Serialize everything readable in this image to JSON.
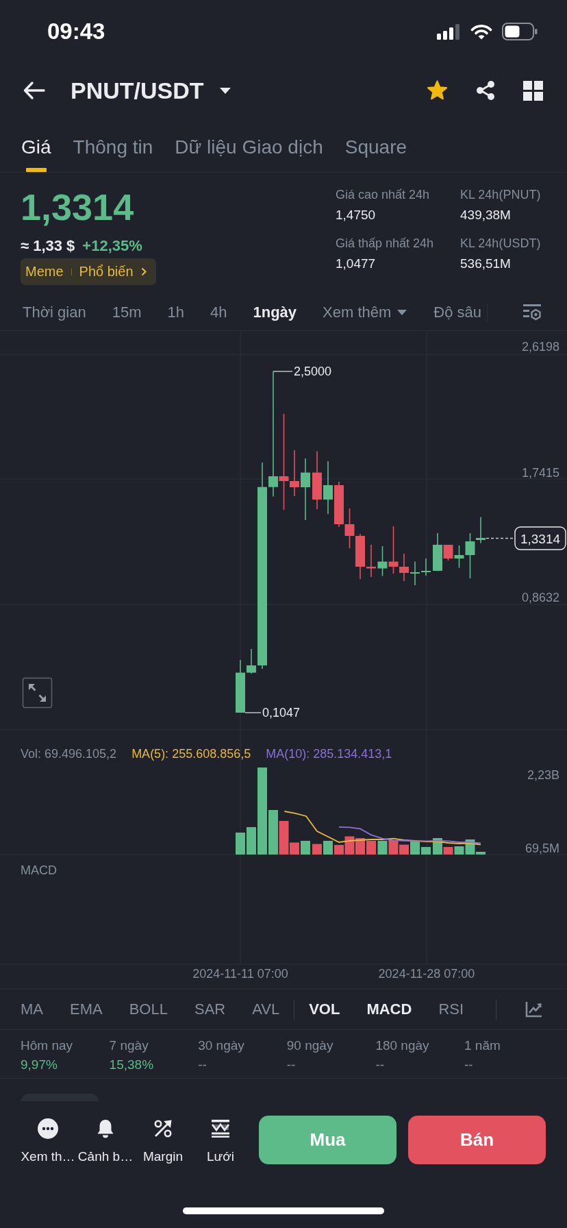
{
  "status_bar": {
    "time": "09:43"
  },
  "header": {
    "pair": "PNUT/USDT",
    "favorite": true
  },
  "tabs": [
    {
      "label": "Giá",
      "selected": true
    },
    {
      "label": "Thông tin",
      "selected": false
    },
    {
      "label": "Dữ liệu Giao dịch",
      "selected": false
    },
    {
      "label": "Square",
      "selected": false
    }
  ],
  "price": {
    "last": "1,3314",
    "fiat": "≈ 1,33 $",
    "change": "+12,35%",
    "rising": true,
    "tags": [
      "Meme",
      "Phổ biến"
    ]
  },
  "stats": [
    {
      "label": "Giá cao nhất 24h",
      "value": "1,4750"
    },
    {
      "label": "KL 24h(PNUT)",
      "value": "439,38M"
    },
    {
      "label": "Giá thấp nhất 24h",
      "value": "1,0477"
    },
    {
      "label": "KL 24h(USDT)",
      "value": "536,51M"
    }
  ],
  "intervals": [
    {
      "label": "Thời gian",
      "kind": "option",
      "selected": false
    },
    {
      "label": "15m",
      "kind": "option",
      "selected": false
    },
    {
      "label": "1h",
      "kind": "option",
      "selected": false
    },
    {
      "label": "4h",
      "kind": "option",
      "selected": false
    },
    {
      "label": "1ngày",
      "kind": "option",
      "selected": true
    },
    {
      "label": "Xem thêm",
      "kind": "menu",
      "selected": false
    },
    {
      "label": "Độ sâu",
      "kind": "option",
      "selected": false
    }
  ],
  "chart": {
    "price_axis": [
      "2,6198",
      "1,7415",
      "0,8632"
    ],
    "high_label": "2,5000",
    "low_label": "0,1047",
    "last_price": "1,3314",
    "volume_legend": [
      {
        "text": "Vol: 69.496.105,2",
        "color": "#848e9c"
      },
      {
        "text": "MA(5): 255.608.856,5",
        "color": "#e9b93c"
      },
      {
        "text": "MA(10): 285.134.413,1",
        "color": "#8c6fd8"
      }
    ],
    "volume_axis": [
      "2,23B",
      "69,5M"
    ],
    "macd_label": "MACD",
    "time_axis": [
      "2024-11-11 07:00",
      "2024-11-28 07:00"
    ]
  },
  "main_indicators": [
    {
      "label": "MA",
      "selected": false
    },
    {
      "label": "EMA",
      "selected": false
    },
    {
      "label": "BOLL",
      "selected": false
    },
    {
      "label": "SAR",
      "selected": false
    },
    {
      "label": "AVL",
      "selected": false
    }
  ],
  "sub_indicators": [
    {
      "label": "VOL",
      "selected": true
    },
    {
      "label": "MACD",
      "selected": true
    },
    {
      "label": "RSI",
      "selected": false
    }
  ],
  "performance": [
    {
      "label": "Hôm nay",
      "value": "9,97%",
      "rising": true
    },
    {
      "label": "7 ngày",
      "value": "15,38%",
      "rising": true
    },
    {
      "label": "30 ngày",
      "value": "--",
      "rising": false
    },
    {
      "label": "90 ngày",
      "value": "--",
      "rising": false
    },
    {
      "label": "180 ngày",
      "value": "--",
      "rising": false
    },
    {
      "label": "1 năm",
      "value": "--",
      "rising": false
    }
  ],
  "toolbar": [
    {
      "label": "Xem th…"
    },
    {
      "label": "Cảnh b…"
    },
    {
      "label": "Margin"
    },
    {
      "label": "Lưới"
    }
  ],
  "actions": [
    {
      "label": "Mua",
      "kind": "buy"
    },
    {
      "label": "Bán",
      "kind": "sell"
    }
  ]
}
